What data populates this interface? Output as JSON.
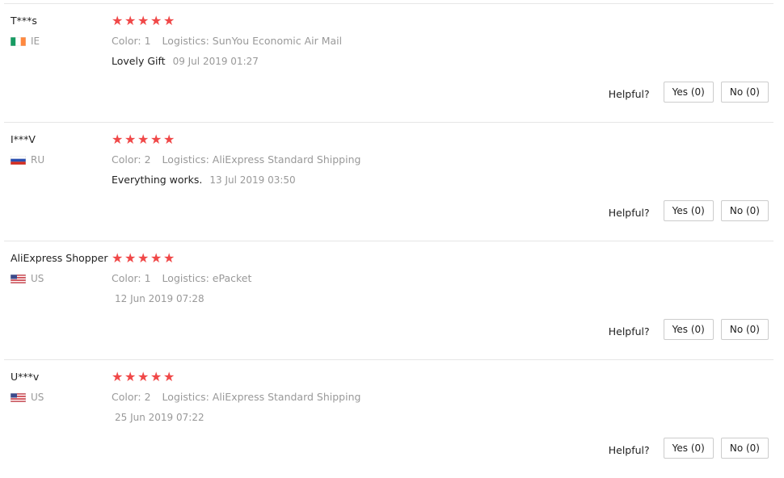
{
  "reviews": [
    {
      "user": "T***s",
      "country": "IE",
      "flag": "ireland",
      "rating": 5,
      "color_label": "Color: 1",
      "logistics_label": "Logistics: SunYou Economic Air Mail",
      "feedback": "Lovely Gift",
      "date": "09 Jul 2019 01:27",
      "helpful_label": "Helpful?",
      "yes_label": "Yes (0)",
      "no_label": "No (0)"
    },
    {
      "user": "I***V",
      "country": "RU",
      "flag": "russia",
      "rating": 5,
      "color_label": "Color: 2",
      "logistics_label": "Logistics: AliExpress Standard Shipping",
      "feedback": "Everything works.",
      "date": "13 Jul 2019 03:50",
      "helpful_label": "Helpful?",
      "yes_label": "Yes (0)",
      "no_label": "No (0)"
    },
    {
      "user": "AliExpress Shopper",
      "country": "US",
      "flag": "usa",
      "rating": 5,
      "color_label": "Color: 1",
      "logistics_label": "Logistics: ePacket",
      "feedback": "",
      "date": "12 Jun 2019 07:28",
      "helpful_label": "Helpful?",
      "yes_label": "Yes (0)",
      "no_label": "No (0)"
    },
    {
      "user": "U***v",
      "country": "US",
      "flag": "usa",
      "rating": 5,
      "color_label": "Color: 2",
      "logistics_label": "Logistics: AliExpress Standard Shipping",
      "feedback": "",
      "date": "25 Jun 2019 07:22",
      "helpful_label": "Helpful?",
      "yes_label": "Yes (0)",
      "no_label": "No (0)"
    }
  ],
  "star_icon": "star-icon",
  "colors": {
    "star": "#f04848",
    "muted_text": "#999999",
    "divider": "#e6e6e6"
  }
}
